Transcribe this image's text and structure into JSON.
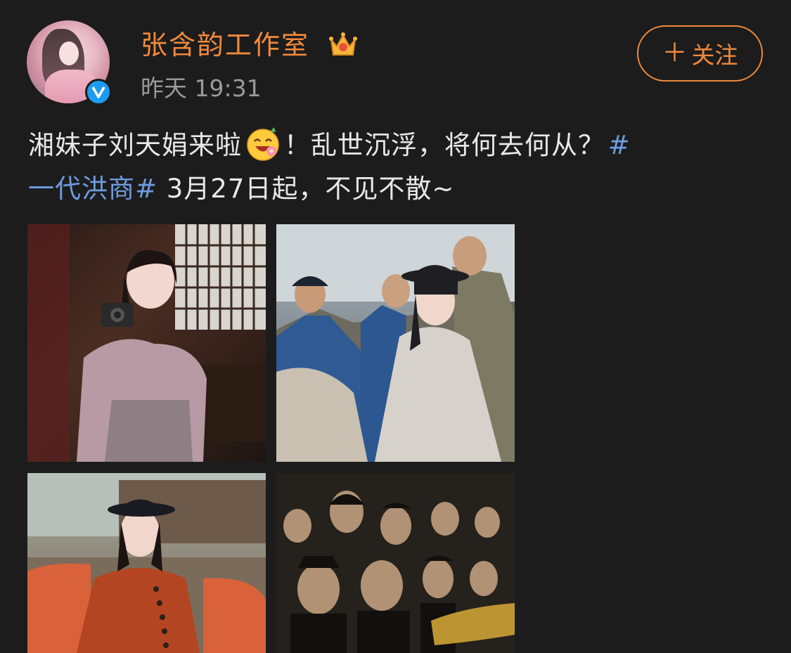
{
  "author": {
    "name": "张含韵工作室",
    "timestamp": "昨天 19:31",
    "avatar_icon": "avatar-photo",
    "verified_icon": "verified-badge-icon",
    "member_icon": "crown-icon"
  },
  "actions": {
    "follow_plus": "＋",
    "follow_label": "关注"
  },
  "post": {
    "text_part1": "湘妹子刘天娟来啦",
    "text_part2": "！乱世沉浮，将何去何从？",
    "hashtag_open": "#",
    "hashtag_text": "一代洪商#",
    "text_part3": " 3月27日起，不见不散~"
  },
  "photos": [
    {
      "desc_icon": "photo-woman-with-camera"
    },
    {
      "desc_icon": "photo-woman-in-hat-crowd"
    },
    {
      "desc_icon": "photo-woman-red-coat"
    },
    {
      "desc_icon": "photo-cast-poster"
    }
  ],
  "colors": {
    "background": "#1c1c1c",
    "username": "#f08a3c",
    "follow_border": "#f08a3c",
    "hashtag": "#6e9be0",
    "timestamp": "#9a9a9a",
    "verified": "#1d9bf0"
  }
}
